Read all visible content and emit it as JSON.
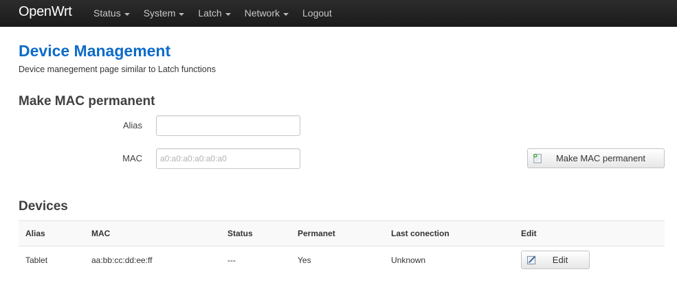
{
  "navbar": {
    "brand": "OpenWrt",
    "items": [
      {
        "label": "Status",
        "dropdown": true
      },
      {
        "label": "System",
        "dropdown": true
      },
      {
        "label": "Latch",
        "dropdown": true
      },
      {
        "label": "Network",
        "dropdown": true
      },
      {
        "label": "Logout",
        "dropdown": false
      }
    ]
  },
  "page": {
    "title": "Device Management",
    "description": "Device manegement page similar to Latch functions"
  },
  "make_mac": {
    "section_title": "Make MAC permanent",
    "alias_label": "Alias",
    "alias_value": "",
    "mac_label": "MAC",
    "mac_placeholder": "a0:a0:a0:a0:a0:a0",
    "submit_label": "Make MAC permanent",
    "submit_icon": "add-document-icon"
  },
  "devices": {
    "section_title": "Devices",
    "columns": [
      "Alias",
      "MAC",
      "Status",
      "Permanet",
      "Last conection",
      "Edit"
    ],
    "rows": [
      {
        "alias": "Tablet",
        "mac": "aa:bb:cc:dd:ee:ff",
        "status": "---",
        "permanent": "Yes",
        "last_connection": "Unknown",
        "edit_label": "Edit",
        "edit_icon": "edit-icon"
      }
    ]
  }
}
